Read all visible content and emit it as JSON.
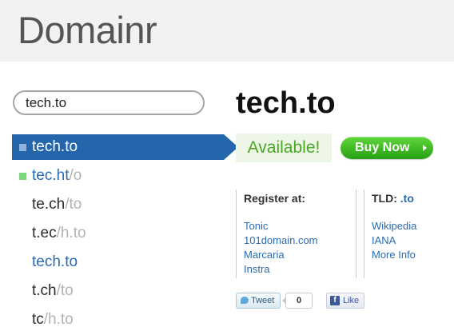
{
  "header": {
    "logo": "Domainr"
  },
  "search": {
    "value": "tech.to"
  },
  "results": [
    {
      "domain": "tech.to",
      "suffix": "",
      "state": "selected"
    },
    {
      "domain": "tec.ht",
      "suffix": "/o",
      "state": "available"
    },
    {
      "domain": "te.ch",
      "suffix": "/to",
      "state": "taken"
    },
    {
      "domain": "t.ec",
      "suffix": "/h.to",
      "state": "taken"
    },
    {
      "domain": "tech.to",
      "suffix": "",
      "state": "link"
    },
    {
      "domain": "t.ch",
      "suffix": "/to",
      "state": "taken"
    },
    {
      "domain": "tc",
      "suffix": "/h.to",
      "state": "taken"
    }
  ],
  "detail": {
    "title": "tech.to",
    "status": "Available!",
    "buy_label": "Buy Now",
    "register_heading": "Register at:",
    "registrars": [
      "Tonic",
      "101domain.com",
      "Marcaria",
      "Instra"
    ],
    "tld_heading": "TLD:",
    "tld": ".to",
    "tld_links": [
      "Wikipedia",
      "IANA",
      "More Info"
    ]
  },
  "social": {
    "tweet_label": "Tweet",
    "tweet_count": "0",
    "like_label": "Like",
    "fb_glyph": "f"
  },
  "colors": {
    "selected_bg": "#2466ac",
    "link": "#2a6bb0",
    "available_text": "#4aa825",
    "available_bg": "#eef6e8",
    "buy_green": "#3cbf23",
    "header_bg": "#f2f2f0"
  }
}
